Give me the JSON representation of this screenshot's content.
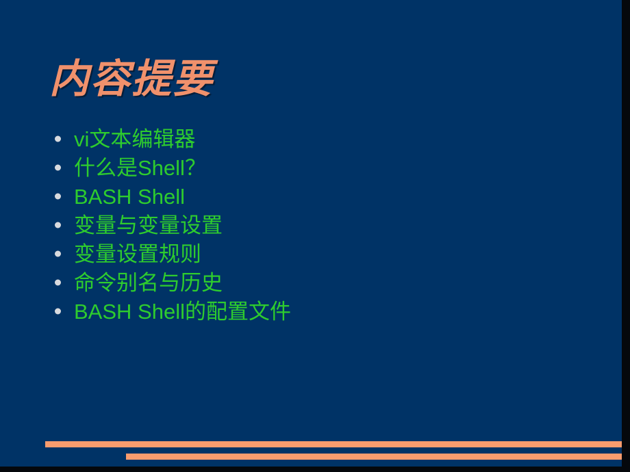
{
  "slide": {
    "title": "内容提要",
    "background_color": "#003366",
    "title_color": "#f0916c",
    "bullet_text_color": "#2ecc2e",
    "bullet_marker_color": "#d8dade",
    "accent_bar_color": "#f99c6e",
    "bullets": [
      {
        "latin_prefix": "vi",
        "cjk": "文本编辑器",
        "latin_suffix": "",
        "full": "vi文本编辑器"
      },
      {
        "latin_prefix": "",
        "cjk": "什么是",
        "latin_suffix": "Shell",
        "tail": "？",
        "full": "什么是Shell？"
      },
      {
        "latin_prefix": "BASH Shell",
        "cjk": "",
        "latin_suffix": "",
        "full": "BASH Shell"
      },
      {
        "latin_prefix": "",
        "cjk": "变量与变量设置",
        "latin_suffix": "",
        "full": "变量与变量设置"
      },
      {
        "latin_prefix": "",
        "cjk": "变量设置规则",
        "latin_suffix": "",
        "full": "变量设置规则"
      },
      {
        "latin_prefix": "",
        "cjk": "命令别名与历史",
        "latin_suffix": "",
        "full": "命令别名与历史"
      },
      {
        "latin_prefix": "BASH Shell",
        "cjk": "的配置文件",
        "latin_suffix": "",
        "full": "BASH Shell的配置文件"
      }
    ]
  }
}
